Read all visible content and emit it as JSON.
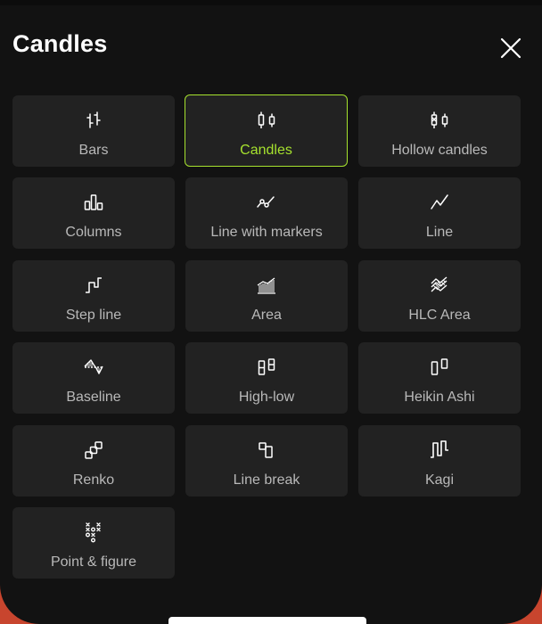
{
  "sheet": {
    "title": "Candles",
    "close_icon": "close-icon"
  },
  "accent_color": "#a6e22e",
  "selected_type": "Candles",
  "chart_types": [
    {
      "label": "Bars",
      "icon": "bars-icon"
    },
    {
      "label": "Candles",
      "icon": "candles-icon",
      "selected": true
    },
    {
      "label": "Hollow candles",
      "icon": "hollow-candles-icon"
    },
    {
      "label": "Columns",
      "icon": "columns-icon"
    },
    {
      "label": "Line with markers",
      "icon": "line-markers-icon"
    },
    {
      "label": "Line",
      "icon": "line-icon"
    },
    {
      "label": "Step line",
      "icon": "step-line-icon"
    },
    {
      "label": "Area",
      "icon": "area-icon"
    },
    {
      "label": "HLC Area",
      "icon": "hlc-area-icon"
    },
    {
      "label": "Baseline",
      "icon": "baseline-icon"
    },
    {
      "label": "High-low",
      "icon": "high-low-icon"
    },
    {
      "label": "Heikin Ashi",
      "icon": "heikin-ashi-icon"
    },
    {
      "label": "Renko",
      "icon": "renko-icon"
    },
    {
      "label": "Line break",
      "icon": "line-break-icon"
    },
    {
      "label": "Kagi",
      "icon": "kagi-icon"
    },
    {
      "label": "Point & figure",
      "icon": "point-figure-icon"
    }
  ]
}
